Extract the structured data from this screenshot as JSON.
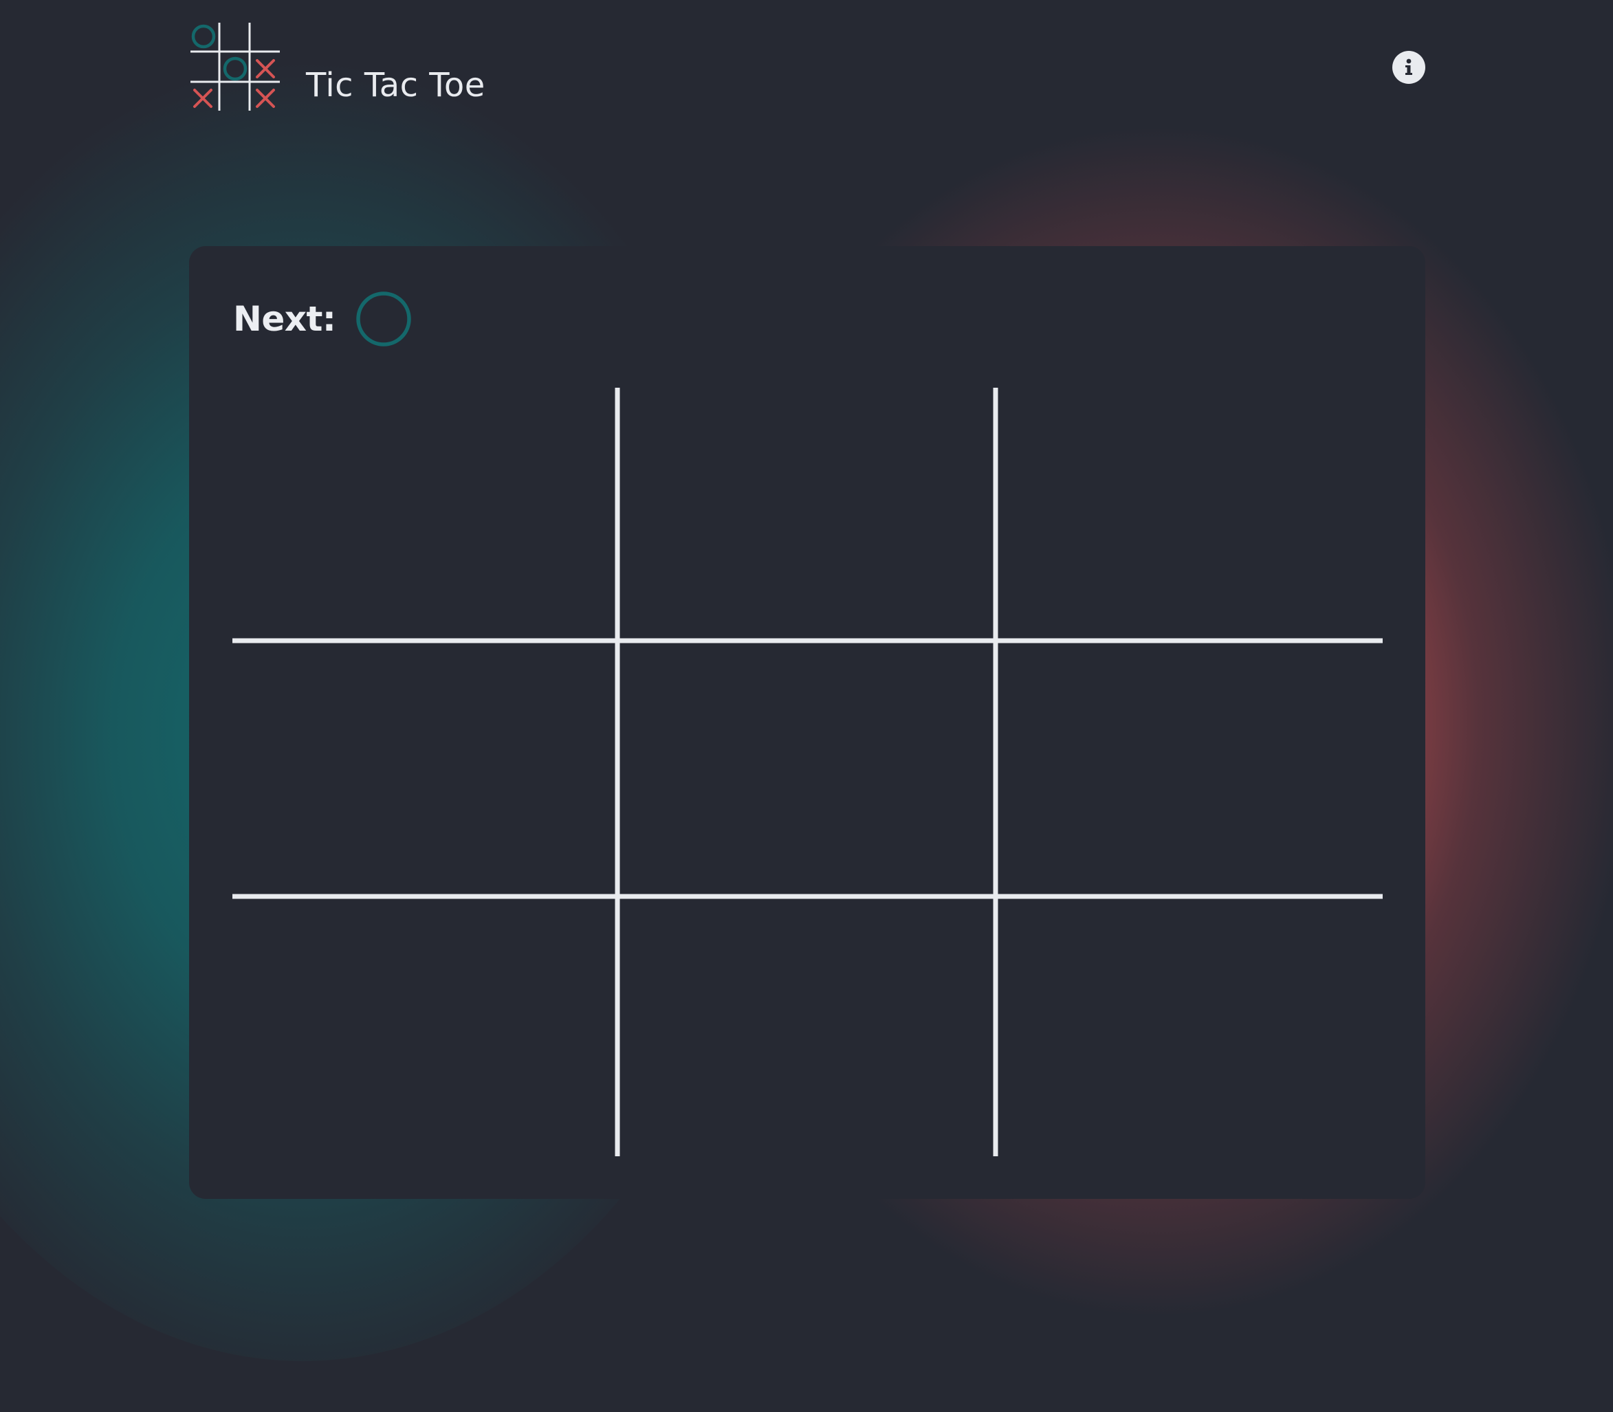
{
  "app": {
    "title": "Tic Tac Toe"
  },
  "header": {
    "logo_icon": "tic-tac-toe-logo-icon",
    "info_icon": "info-icon"
  },
  "game": {
    "next_label": "Next:",
    "next_player": "O",
    "board": [
      [
        "",
        "",
        ""
      ],
      [
        "",
        "",
        ""
      ],
      [
        "",
        "",
        ""
      ]
    ]
  },
  "colors": {
    "background": "#262933",
    "o_color": "#14686b",
    "x_color": "#d65454",
    "grid_line": "#e9ebef",
    "text": "#e9ebef"
  }
}
